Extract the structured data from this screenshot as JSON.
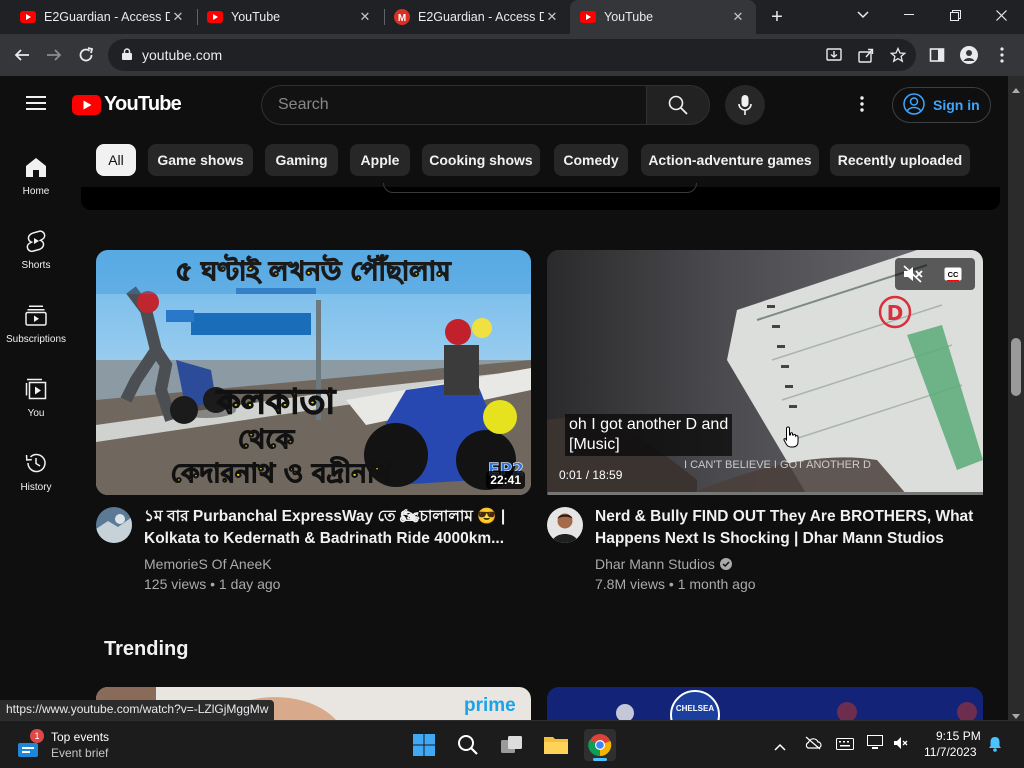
{
  "browser": {
    "tabs": [
      {
        "label": "E2Guardian - Access D",
        "icon": "youtube-favicon"
      },
      {
        "label": "YouTube",
        "icon": "youtube-favicon"
      },
      {
        "label": "E2Guardian - Access D",
        "icon": "gmail-favicon"
      },
      {
        "label": "YouTube",
        "icon": "youtube-favicon"
      }
    ],
    "url": "youtube.com",
    "status_url": "https://www.youtube.com/watch?v=-LZlGjMggMw"
  },
  "youtube": {
    "logo_text": "YouTube",
    "search_placeholder": "Search",
    "signin_label": "Sign in",
    "guide": [
      {
        "label": "Home",
        "icon": "home-icon"
      },
      {
        "label": "Shorts",
        "icon": "shorts-icon"
      },
      {
        "label": "Subscriptions",
        "icon": "subscriptions-icon"
      },
      {
        "label": "You",
        "icon": "you-icon"
      },
      {
        "label": "History",
        "icon": "history-icon"
      }
    ],
    "chips": [
      "All",
      "Game shows",
      "Gaming",
      "Apple",
      "Cooking shows",
      "Comedy",
      "Action-adventure games",
      "Recently uploaded"
    ],
    "videos": [
      {
        "title_line1": "১ম বার Purbanchal ExpressWay তে 🏍চালালাম 😎 |",
        "title_line2": "Kolkata to Kedernath & Badrinath Ride 4000km...",
        "channel": "MemorieS Of AneeK",
        "stats": "125 views • 1 day ago",
        "duration": "22:41",
        "thumb_text_top": "৫ ঘণ্টাই লখনউ পৌঁছালাম",
        "thumb_text_mid": "কলকাতা",
        "thumb_text_mid2": "থেকে",
        "thumb_text_bottom": "কেদারনাথ ও বদ্রীনাথ",
        "thumb_badge": "EP2"
      },
      {
        "title_line1": "Nerd & Bully FIND OUT They Are BROTHERS, What",
        "title_line2": "Happens Next Is Shocking | Dhar Mann Studios",
        "channel": "Dhar Mann Studios",
        "stats": "7.8M views • 1 month ago",
        "caption_line1": "oh I got another D and",
        "caption_line2": "[Music]",
        "time": "0:01 / 18:59",
        "burned_text": "I CAN'T BELIEVE I GOT ANOTHER D",
        "watermark": "Dha",
        "paper_grade": "D"
      }
    ],
    "section_title": "Trending",
    "trending_thumb1_text": "prime",
    "trending_thumb2_text": "CHELSEA"
  },
  "taskbar": {
    "notif_badge": "1",
    "widget_title": "Top events",
    "widget_sub": "Event brief",
    "time": "9:15 PM",
    "date": "11/7/2023"
  }
}
